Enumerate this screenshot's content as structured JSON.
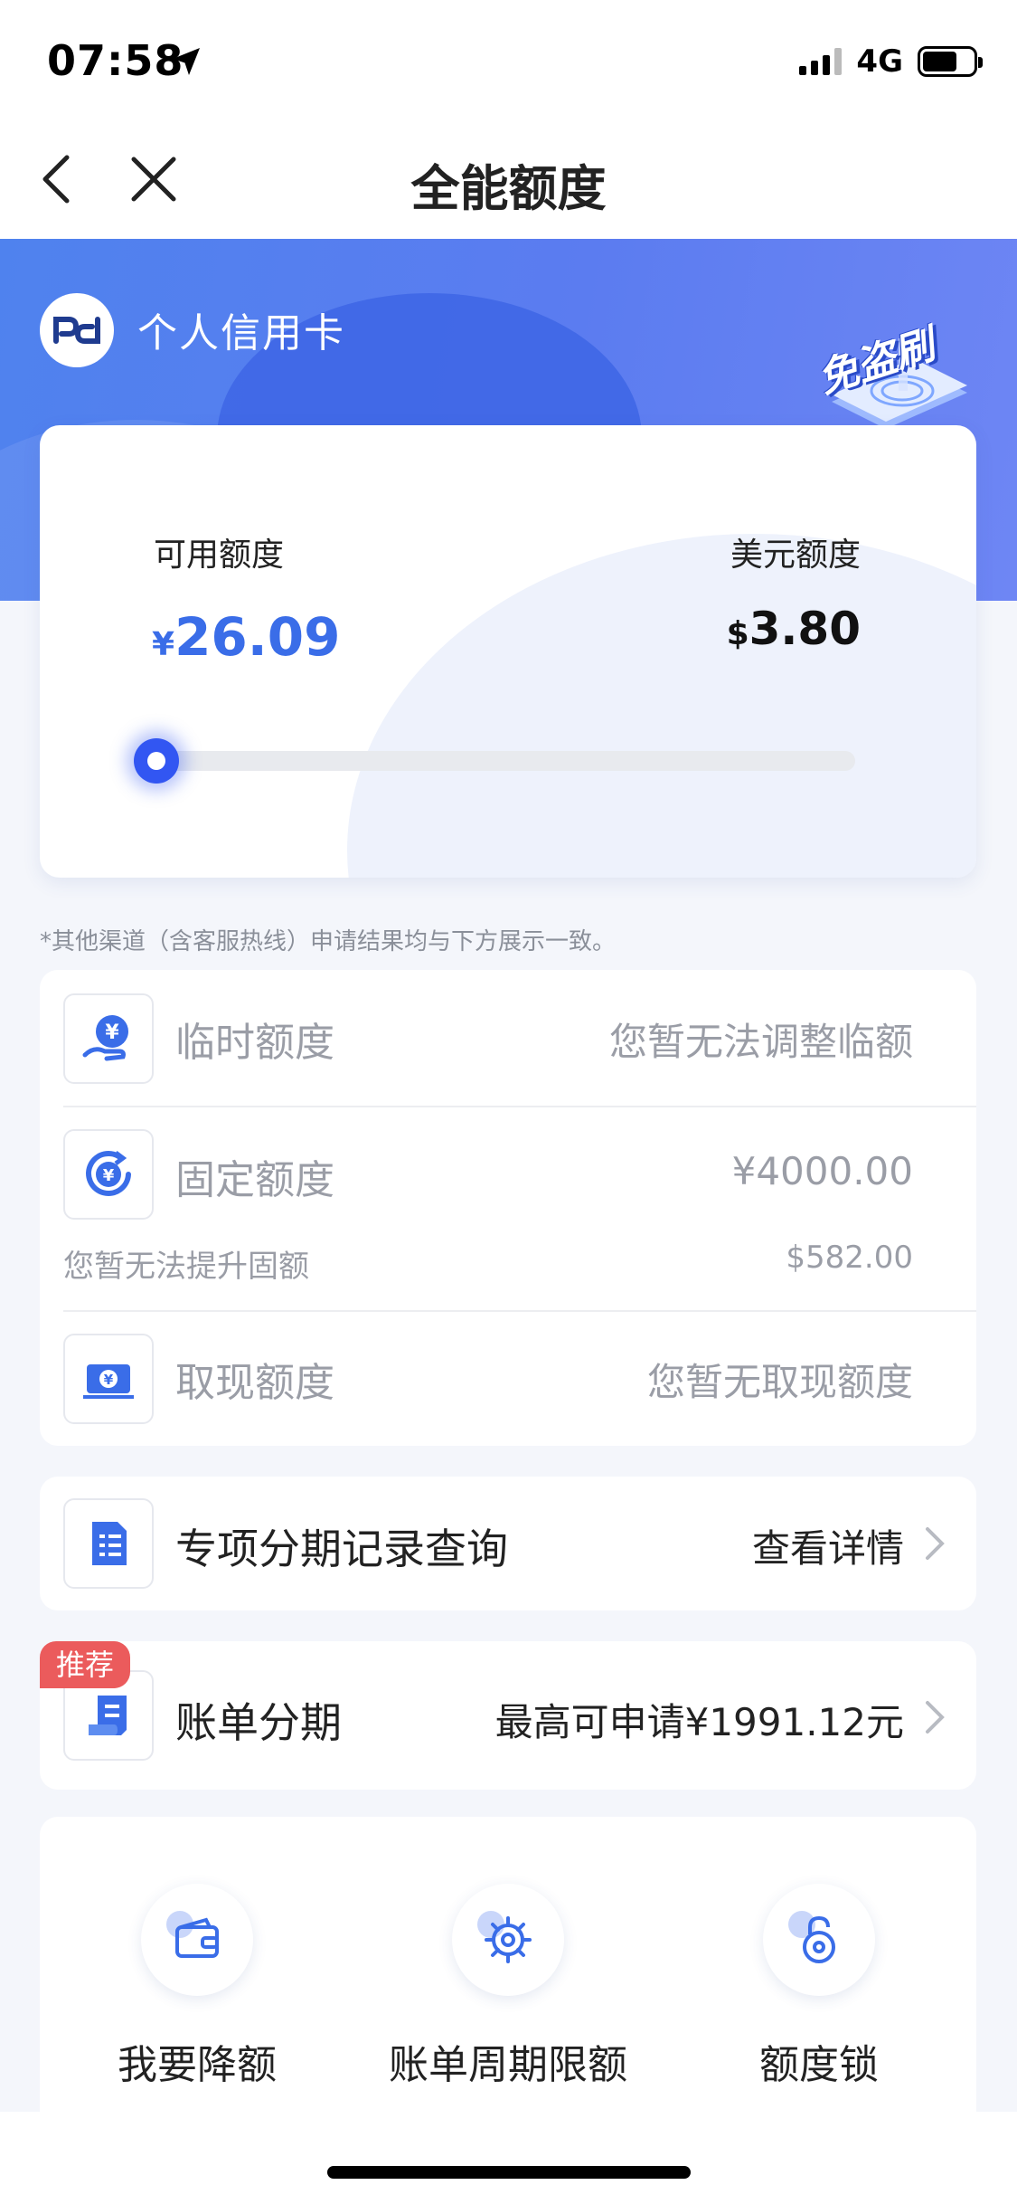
{
  "status_bar": {
    "time": "07:58",
    "network": "4G"
  },
  "nav": {
    "title": "全能额度"
  },
  "header": {
    "card_type": "个人信用卡",
    "badge_text": "免盗刷"
  },
  "limit": {
    "available_label": "可用额度",
    "available_currency": "¥",
    "available_value": "26.09",
    "usd_label": "美元额度",
    "usd_currency": "$",
    "usd_value": "3.80",
    "used_fraction": 0.0
  },
  "notice": "*其他渠道（含客服热线）申请结果均与下方展示一致。",
  "quota_rows": [
    {
      "title": "临时额度",
      "value": "您暂无法调整临额",
      "icon": "temp-limit-icon"
    },
    {
      "title": "固定额度",
      "value": "¥4000.00",
      "sub_left": "您暂无法提升固额",
      "sub_right": "$582.00",
      "icon": "fixed-limit-icon"
    },
    {
      "title": "取现额度",
      "value": "您暂无取现额度",
      "icon": "cash-limit-icon"
    }
  ],
  "installment_query": {
    "title": "专项分期记录查询",
    "value": "查看详情"
  },
  "bill_installment": {
    "badge": "推荐",
    "title": "账单分期",
    "value": "最高可申请¥1991.12元"
  },
  "actions": [
    {
      "label": "我要降额",
      "icon": "wallet-icon"
    },
    {
      "label": "账单周期限额",
      "icon": "gear-icon"
    },
    {
      "label": "额度锁",
      "icon": "lock-icon"
    }
  ],
  "colors": {
    "primary": "#3A6DE8",
    "hero": "#5B7CF0",
    "badge": "#EB5B5C"
  }
}
